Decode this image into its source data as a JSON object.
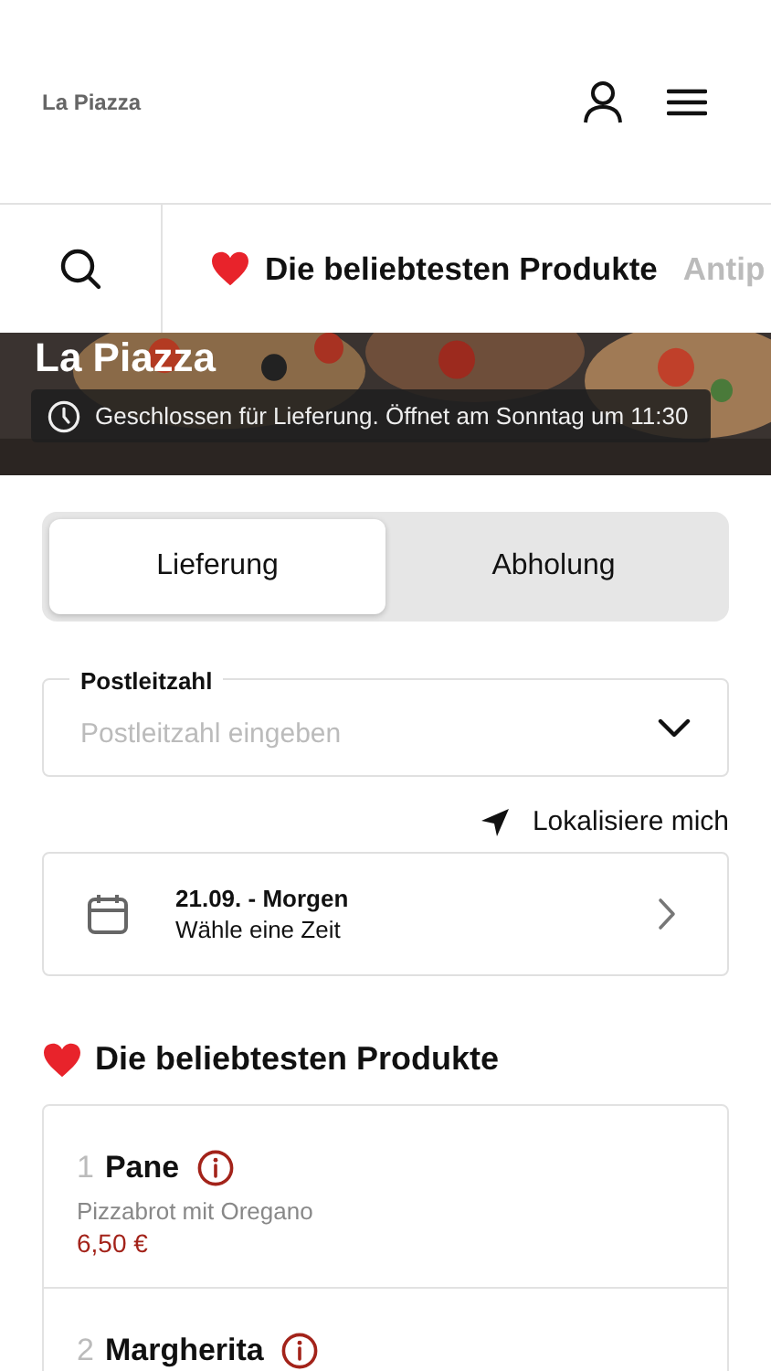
{
  "header": {
    "title": "La Piazza"
  },
  "categories": [
    {
      "label": "Die beliebtesten Produkte",
      "selected": true,
      "heart": true
    },
    {
      "label": "Antip",
      "selected": false,
      "heart": false
    }
  ],
  "banner": {
    "title": "La Piazza",
    "status": "Geschlossen für Lieferung. Öffnet am Sonntag um 11:30"
  },
  "modes": [
    {
      "label": "Lieferung",
      "selected": true
    },
    {
      "label": "Abholung",
      "selected": false
    }
  ],
  "zip": {
    "label": "Postleitzahl",
    "placeholder": "Postleitzahl eingeben"
  },
  "locate": {
    "label": "Lokalisiere mich"
  },
  "date": {
    "title": "21.09. - Morgen",
    "subtitle": "Wähle eine Zeit"
  },
  "section": {
    "title": "Die beliebtesten Produkte"
  },
  "products": [
    {
      "number": "1",
      "name": "Pane",
      "description": "Pizzabrot mit Oregano",
      "price": "6,50 €"
    },
    {
      "number": "2",
      "name": "Margherita"
    }
  ]
}
